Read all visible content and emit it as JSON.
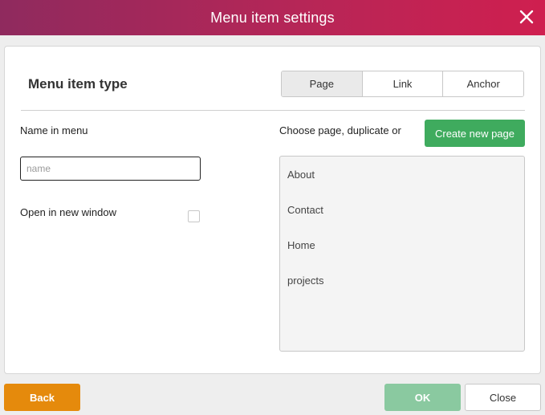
{
  "window": {
    "title": "Menu item settings",
    "close_icon": "close-x-icon"
  },
  "menu_item_type": {
    "heading": "Menu item type",
    "tabs": [
      {
        "label": "Page",
        "active": true
      },
      {
        "label": "Link",
        "active": false
      },
      {
        "label": "Anchor",
        "active": false
      }
    ]
  },
  "name_field": {
    "label": "Name in menu",
    "value": "",
    "placeholder": "name"
  },
  "open_new_window": {
    "label": "Open in new window",
    "checked": false
  },
  "pages": {
    "label": "Choose page, duplicate or",
    "create_button": "Create new page",
    "items": [
      "About",
      "Contact",
      "Home",
      "projects"
    ]
  },
  "footer": {
    "back": "Back",
    "ok": "OK",
    "close": "Close"
  },
  "colors": {
    "title_gradient_start": "#8f2a5e",
    "title_gradient_end": "#cf1f4f",
    "create_button": "#3fab5e",
    "back_button": "#e58a0c",
    "ok_button": "#8ac9a0"
  }
}
